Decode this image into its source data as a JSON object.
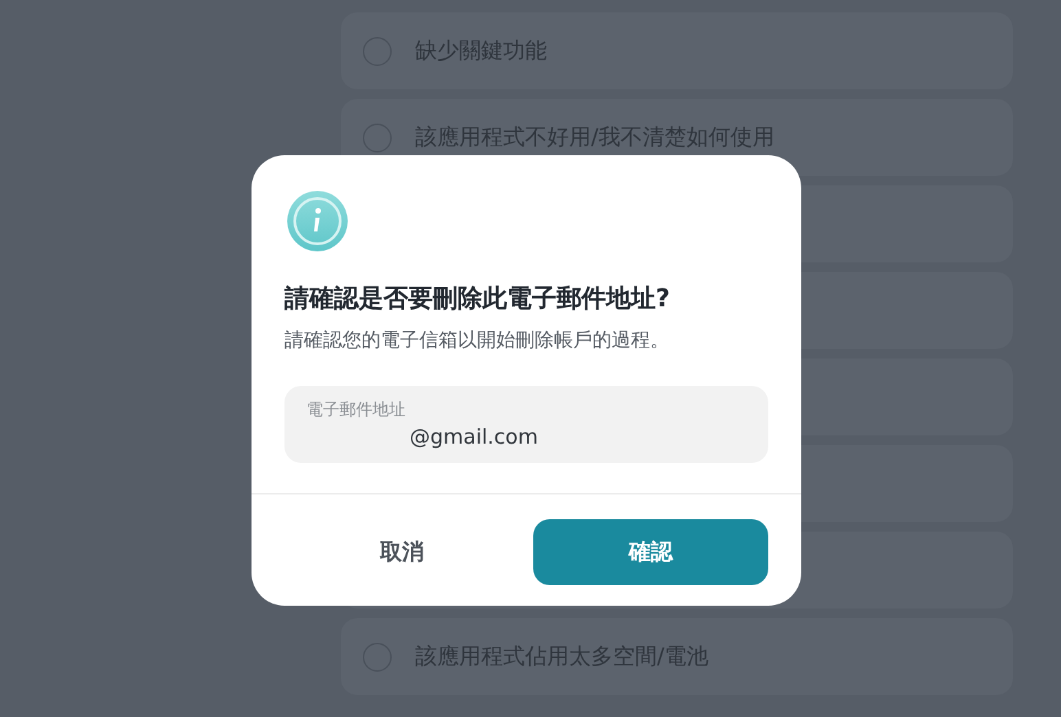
{
  "options": [
    {
      "kind": "option",
      "label": "缺少關鍵功能",
      "selected": false
    },
    {
      "kind": "option",
      "label": "該應用程式不好用/我不清楚如何使用",
      "selected": false
    },
    {
      "kind": "covered"
    },
    {
      "kind": "covered"
    },
    {
      "kind": "covered"
    },
    {
      "kind": "covered"
    },
    {
      "kind": "covered"
    },
    {
      "kind": "option",
      "label": "該應用程式佔用太多空間/電池",
      "selected": false
    }
  ],
  "dialog": {
    "title": "請確認是否要刪除此電子郵件地址?",
    "message": "請確認您的電子信箱以開始刪除帳戶的過程。",
    "email_field": {
      "label": "電子郵件地址",
      "value": "@gmail.com"
    },
    "buttons": [
      {
        "kind": "secondary",
        "label": "取消"
      },
      {
        "kind": "primary",
        "label": "確認"
      }
    ]
  }
}
